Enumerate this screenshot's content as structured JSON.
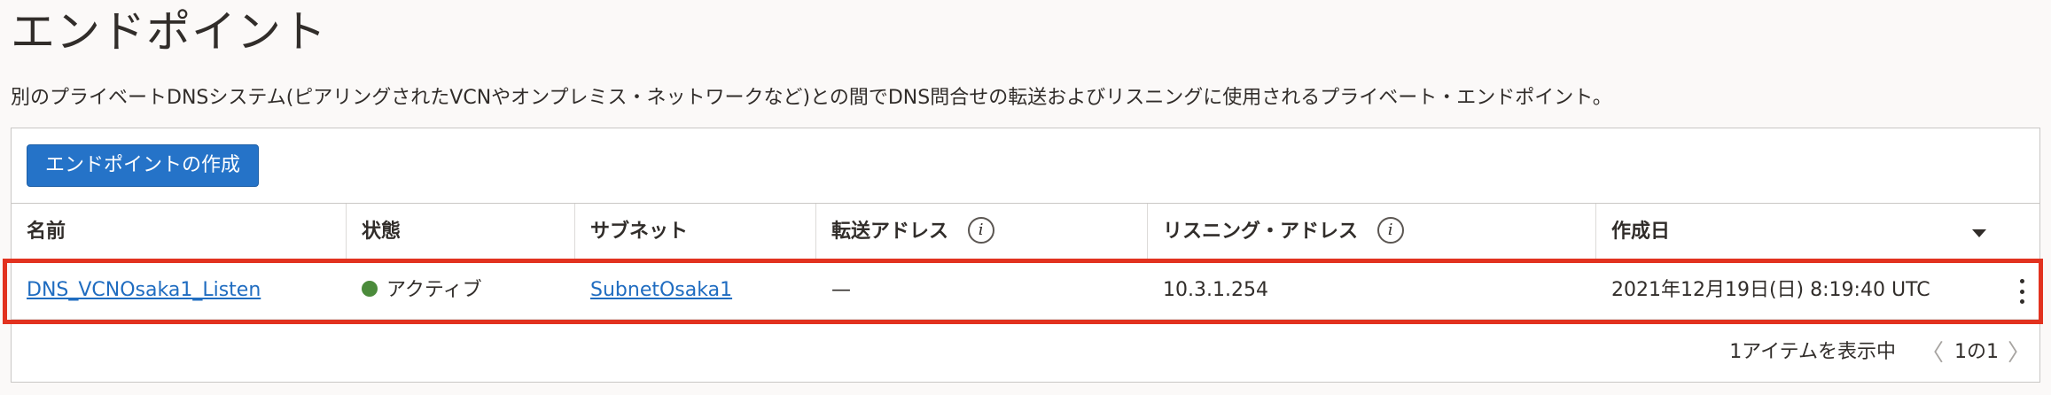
{
  "page": {
    "title": "エンドポイント",
    "description": "別のプライベートDNSシステム(ピアリングされたVCNやオンプレミス・ネットワークなど)との間でDNS問合せの転送およびリスニングに使用されるプライベート・エンドポイント。"
  },
  "toolbar": {
    "create_label": "エンドポイントの作成"
  },
  "table": {
    "columns": {
      "name": "名前",
      "state": "状態",
      "subnet": "サブネット",
      "forward_address": "転送アドレス",
      "listen_address": "リスニング・アドレス",
      "created": "作成日"
    },
    "info_glyph": "i",
    "rows": [
      {
        "name": "DNS_VCNOsaka1_Listen",
        "state": "アクティブ",
        "state_color": "#4b8b3b",
        "subnet": "SubnetOsaka1",
        "forward_address": "—",
        "listen_address": "10.3.1.254",
        "created": "2021年12月19日(日) 8:19:40 UTC"
      }
    ]
  },
  "footer": {
    "count_text": "1アイテムを表示中",
    "page_text": "1の1",
    "prev_glyph": "〈",
    "next_glyph": "〉"
  },
  "colors": {
    "accent": "#2573c8",
    "link": "#1f6cc0",
    "highlight": "#e2321f"
  }
}
